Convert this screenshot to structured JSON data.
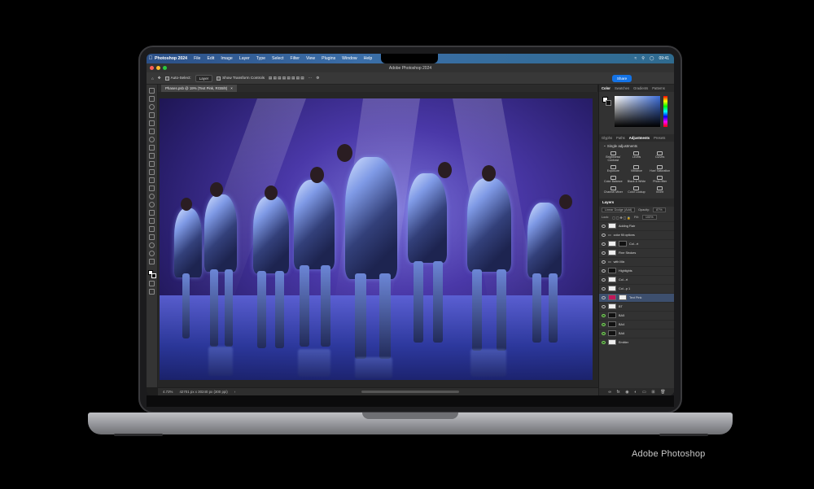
{
  "menubar": {
    "app_name": "Photoshop 2024",
    "items": [
      "File",
      "Edit",
      "Image",
      "Layer",
      "Type",
      "Select",
      "Filter",
      "View",
      "Plugins",
      "Window",
      "Help"
    ],
    "clock": "09:41"
  },
  "window": {
    "title": "Adobe Photoshop 2024"
  },
  "options_bar": {
    "auto_select_label": "Auto-Select:",
    "auto_select_target": "Layer",
    "transform_controls_label": "Show Transform Controls",
    "share_label": "Share"
  },
  "document": {
    "tab_label": "Phases.psb @ 19% (Text Pink, RGB/8)",
    "zoom": "4.72%",
    "doc_info": "42701 px x 30240 px (300 ppi)"
  },
  "color_panel": {
    "tabs": [
      "Color",
      "Swatches",
      "Gradients",
      "Patterns"
    ],
    "active_tab": "Color",
    "foreground": "#ffffff",
    "background": "#000000"
  },
  "adjustments_panel": {
    "tabs": [
      "Glyphs",
      "Paths",
      "Adjustments",
      "Presets"
    ],
    "active_tab": "Adjustments",
    "section_title": "Single adjustments",
    "items": [
      "Brightness/ Contrast",
      "Levels",
      "Curves",
      "Exposure",
      "Vibrance",
      "Hue/ Saturation",
      "Color Balance",
      "Black & White",
      "Photo filter",
      "Channel Mixer",
      "Color Lookup",
      "Invert"
    ]
  },
  "layers_panel": {
    "title": "Layers",
    "blend_mode": "Linear Dodge (Add)",
    "opacity_label": "Opacity:",
    "opacity_value": "87%",
    "lock_label": "Lock:",
    "fill_label": "Fill:",
    "fill_value": "100%",
    "layers": [
      {
        "name": "Adding Flair"
      },
      {
        "name": "color fill options"
      },
      {
        "name": "Col...rt"
      },
      {
        "name": "Fine Strokes"
      },
      {
        "name": "with Mix"
      },
      {
        "name": "Highlights"
      },
      {
        "name": "Col...rt"
      },
      {
        "name": "Col...p 1"
      },
      {
        "name": "Text Pink"
      },
      {
        "name": "BT"
      },
      {
        "name": "BA5"
      },
      {
        "name": "BA4"
      },
      {
        "name": "BA6"
      },
      {
        "name": "Emitter"
      }
    ]
  },
  "caption": "Adobe Photoshop"
}
